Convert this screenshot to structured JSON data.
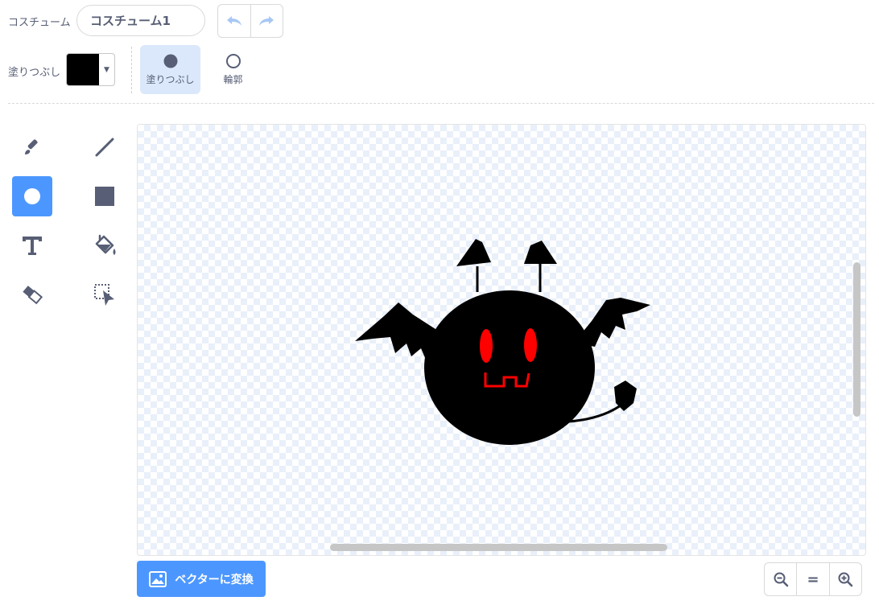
{
  "costume": {
    "label": "コスチューム",
    "name_value": "コスチューム1"
  },
  "fill": {
    "label": "塗りつぶし",
    "color": "#000000"
  },
  "modes": {
    "fill_label": "塗りつぶし",
    "outline_label": "輪郭"
  },
  "tools": [
    "brush",
    "line",
    "circle",
    "rectangle",
    "text",
    "fill",
    "eraser",
    "select"
  ],
  "active_tool": "circle",
  "colors": {
    "accent": "#4c97ff",
    "drawing": "#000000",
    "eyes": "#ff0000"
  },
  "convert_button": {
    "label": "ベクターに変換"
  },
  "zoom": {
    "reset_label": "="
  }
}
